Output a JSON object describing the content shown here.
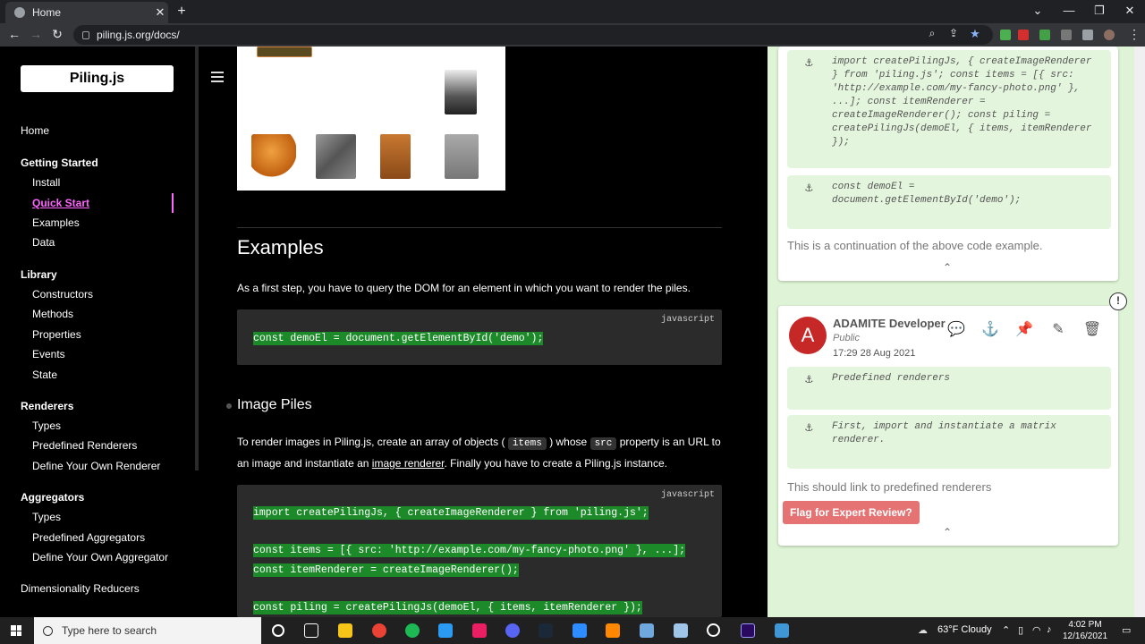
{
  "browser": {
    "tab_title": "Home",
    "url": "piling.js.org/docs/"
  },
  "sidebar": {
    "logo": "Piling.js",
    "home": "Home",
    "sections": [
      {
        "title": "Getting Started",
        "items": [
          "Install",
          "Quick Start",
          "Examples",
          "Data"
        ]
      },
      {
        "title": "Library",
        "items": [
          "Constructors",
          "Methods",
          "Properties",
          "Events",
          "State"
        ]
      },
      {
        "title": "Renderers",
        "items": [
          "Types",
          "Predefined Renderers",
          "Define Your Own Renderer"
        ]
      },
      {
        "title": "Aggregators",
        "items": [
          "Types",
          "Predefined Aggregators",
          "Define Your Own Aggregator"
        ]
      }
    ],
    "dimensionality": "Dimensionality Reducers",
    "active_item": "Quick Start"
  },
  "content": {
    "examples_heading": "Examples",
    "examples_para": "As a first step, you have to query the DOM for an element in which you want to render the piles.",
    "code1_lang": "javascript",
    "code1_line": "const demoEl = document.getElementById('demo');",
    "image_piles_heading": "Image Piles",
    "piles_para_1": "To render images in Piling.js, create an array of objects (",
    "piles_code_items": "items",
    "piles_para_2": ") whose",
    "piles_code_src": "src",
    "piles_para_3": "property is an URL to an image and instantiate an",
    "piles_link": "image renderer",
    "piles_para_4": ". Finally you have to create a Piling.js instance.",
    "code2_lang": "javascript",
    "code2_lines": [
      "import createPilingJs, { createImageRenderer } from 'piling.js';",
      "const items = [{ src: 'http://example.com/my-fancy-photo.png' }, ...];",
      "const itemRenderer = createImageRenderer();",
      "const piling = createPilingJs(demoEl, { items, itemRenderer });"
    ]
  },
  "annotations": {
    "card1": {
      "quote1": "import createPilingJs, { createImageRenderer } from 'piling.js'; const items = [{ src: 'http://example.com/my-fancy-photo.png' }, ...]; const itemRenderer = createImageRenderer(); const piling = createPilingJs(demoEl, { items, itemRenderer });",
      "quote2": "const demoEl = document.getElementById('demo');",
      "note": "This is a continuation of the above code example."
    },
    "card2": {
      "avatar_letter": "A",
      "author": "ADAMITE Developer",
      "visibility": "Public",
      "timestamp": "17:29 28 Aug 2021",
      "quote1": "Predefined renderers",
      "quote2": "First, import and instantiate a matrix renderer.",
      "note": "This should link to predefined renderers",
      "flag_button": "Flag for Expert Review?"
    }
  },
  "taskbar": {
    "search_placeholder": "Type here to search",
    "weather": "63°F  Cloudy",
    "time": "4:02 PM",
    "date": "12/16/2021"
  }
}
